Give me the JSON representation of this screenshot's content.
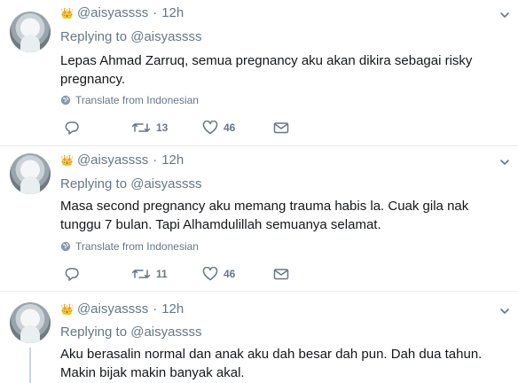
{
  "tweets": [
    {
      "crown": "👑",
      "handle": "@aisyassss",
      "dot": "·",
      "time": "12h",
      "replying_prefix": "Replying to",
      "replying_to": "@aisyassss",
      "text": "Lepas Ahmad Zarruq,  semua pregnancy aku akan dikira sebagai risky pregnancy.",
      "translate": "Translate from Indonesian",
      "retweets": "13",
      "likes": "46"
    },
    {
      "crown": "👑",
      "handle": "@aisyassss",
      "dot": "·",
      "time": "12h",
      "replying_prefix": "Replying to",
      "replying_to": "@aisyassss",
      "text": "Masa second pregnancy aku memang trauma habis la. Cuak gila nak tunggu 7 bulan. Tapi Alhamdulillah semuanya selamat.",
      "translate": "Translate from Indonesian",
      "retweets": "11",
      "likes": "46"
    },
    {
      "crown": "👑",
      "handle": "@aisyassss",
      "dot": "·",
      "time": "12h",
      "replying_prefix": "Replying to",
      "replying_to": "@aisyassss",
      "text": "Aku berasalin normal dan anak aku dah besar dah pun. Dah dua tahun. Makin bijak makin banyak akal."
    }
  ],
  "icons": {
    "reply": "reply-icon",
    "retweet": "retweet-icon",
    "like": "heart-icon",
    "dm": "envelope-icon",
    "globe": "globe-icon",
    "caret": "chevron-down-icon"
  },
  "colors": {
    "secondary_text": "#657786",
    "primary_text": "#14171a",
    "divider": "#e6ecf0",
    "crown": "#e8b923"
  }
}
